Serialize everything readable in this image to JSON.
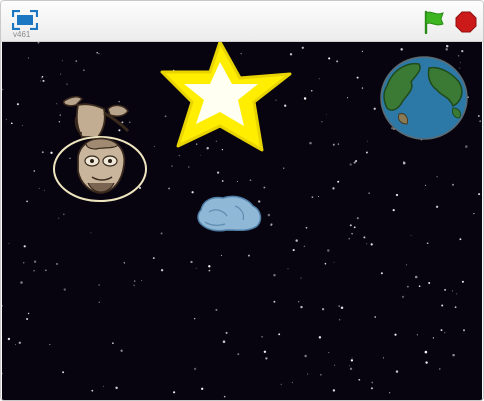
{
  "toolbar": {
    "version_label": "v461",
    "fullscreen_icon": "fullscreen-icon",
    "green_flag_icon": "green-flag-icon",
    "stop_icon": "stop-icon"
  },
  "stage": {
    "background": "#07030f",
    "sprites": [
      "star",
      "earth",
      "astronaut",
      "rock"
    ]
  },
  "colors": {
    "flag": "#3cb521",
    "stop": "#cc1a1a",
    "fullscreen": "#1c77c3",
    "star": "#ffee00"
  }
}
